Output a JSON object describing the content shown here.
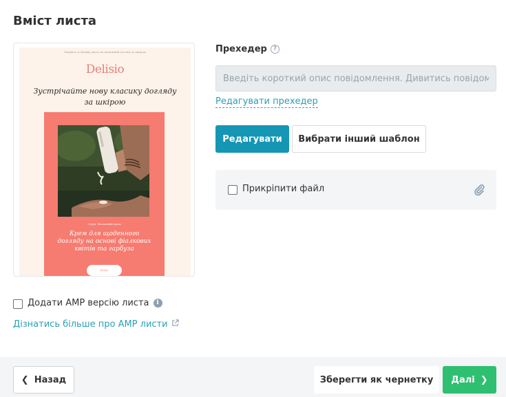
{
  "section": {
    "title": "Вміст листа"
  },
  "email_preview": {
    "preheader_text": "Зверніть особливу увагу на щоденний догляд за шкірою",
    "logo_text": "Delisio",
    "headline": "Зустрічайте нову класику догляду за шкірою",
    "photo_label": "Серія: Фіалковий крем",
    "product_text": "Крем для щоденного догляду на основі фіалкових квітів та гарбуза",
    "cta_label": "Хочу!",
    "colors": {
      "background": "#fdf3ea",
      "accent": "#f67b70",
      "logo": "#e6817a"
    }
  },
  "preheader": {
    "label": "Прехедер",
    "help_icon": "question-circle-icon",
    "placeholder": "Введіть короткий опис повідомлення. Дивитись повідомлення",
    "edit_link": "Редагувати прехедер"
  },
  "actions": {
    "edit_label": "Редагувати",
    "choose_template_label": "Вибрати інший шаблон"
  },
  "attachment": {
    "label": "Прикріпити файл",
    "checked": false,
    "icon": "paperclip-icon"
  },
  "amp": {
    "label": "Додати AMP версію листа",
    "checked": false,
    "info_icon": "info-circle-icon",
    "learn_more_link": "Дізнатись більше про AMP листи",
    "link_icon": "external-link-icon"
  },
  "footer": {
    "back_label": "Назад",
    "save_draft_label": "Зберегти як чернетку",
    "next_label": "Далі"
  },
  "colors": {
    "primary": "#1596b5",
    "link": "#2aa0b5",
    "success": "#2fbf71"
  }
}
